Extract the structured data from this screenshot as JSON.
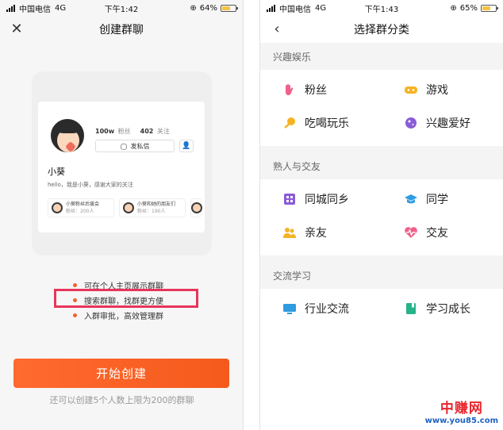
{
  "left": {
    "status": {
      "carrier": "中国电信",
      "network": "4G",
      "time": "下午1:42",
      "battery": "64%",
      "battery_level": 0.64
    },
    "title": "创建群聊",
    "profile": {
      "followers_value": "100w",
      "followers_label": "粉丝",
      "following_value": "402",
      "following_label": "关注",
      "dm_label": "发私信",
      "name": "小葵",
      "bio": "hello，我是小葵，感谢大家的关注",
      "groups": [
        {
          "title": "小葵粉丝后援会",
          "sub": "粉丝：200人"
        },
        {
          "title": "小葵和她的朋友们",
          "sub": "粉丝：190人"
        }
      ]
    },
    "features": [
      "可在个人主页展示群聊",
      "搜索群聊，找群更方便",
      "入群审批，高效管理群"
    ],
    "start_button": "开始创建",
    "footer_note": "还可以创建5个人数上限为200的群聊"
  },
  "right": {
    "status": {
      "carrier": "中国电信",
      "network": "4G",
      "time": "下午1:43",
      "battery": "65%",
      "battery_level": 0.65
    },
    "title": "选择群分类",
    "sections": [
      {
        "title": "兴趣娱乐",
        "items": [
          {
            "label": "粉丝",
            "icon": "fan-hand-icon",
            "color": "#f0608a"
          },
          {
            "label": "游戏",
            "icon": "gamepad-icon",
            "color": "#f5b324"
          },
          {
            "label": "吃喝玩乐",
            "icon": "food-icon",
            "color": "#f5b324"
          },
          {
            "label": "兴趣爱好",
            "icon": "planet-icon",
            "color": "#8b5bd8"
          }
        ]
      },
      {
        "title": "熟人与交友",
        "items": [
          {
            "label": "同城同乡",
            "icon": "building-icon",
            "color": "#8b5bd8"
          },
          {
            "label": "同学",
            "icon": "graduation-cap-icon",
            "color": "#2f9be0"
          },
          {
            "label": "亲友",
            "icon": "people-icon",
            "color": "#f5b324"
          },
          {
            "label": "交友",
            "icon": "heartbeat-icon",
            "color": "#f0608a"
          }
        ]
      },
      {
        "title": "交流学习",
        "items": [
          {
            "label": "行业交流",
            "icon": "monitor-icon",
            "color": "#2f9be0"
          },
          {
            "label": "学习成长",
            "icon": "book-icon",
            "color": "#27b28a"
          }
        ]
      }
    ]
  },
  "watermark": {
    "main": "中赚网",
    "url": "www.you85.com"
  }
}
